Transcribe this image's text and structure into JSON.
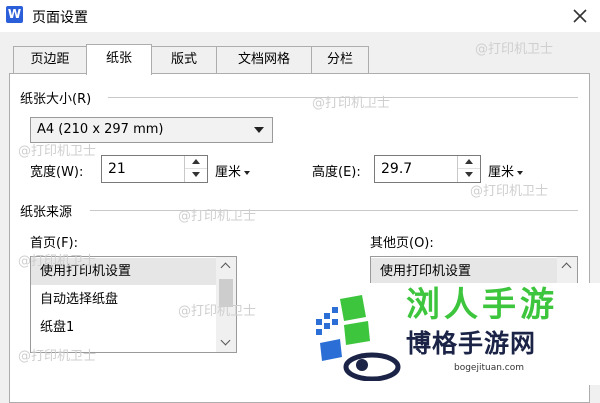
{
  "window": {
    "app_icon": "W",
    "title": "页面设置",
    "close_icon": "close-icon"
  },
  "tabs": [
    {
      "label": "页边距",
      "active": false
    },
    {
      "label": "纸张",
      "active": true
    },
    {
      "label": "版式",
      "active": false
    },
    {
      "label": "文档网格",
      "active": false
    },
    {
      "label": "分栏",
      "active": false
    }
  ],
  "paper_size": {
    "section_label": "纸张大小(R)",
    "selected": "A4 (210 x 297 mm)",
    "width": {
      "label": "宽度(W):",
      "value": "21",
      "unit": "厘米"
    },
    "height": {
      "label": "高度(E):",
      "value": "29.7",
      "unit": "厘米"
    }
  },
  "paper_source": {
    "section_label": "纸张来源",
    "first_page": {
      "label": "首页(F):",
      "items": [
        "使用打印机设置",
        "自动选择纸盘",
        "纸盘1"
      ],
      "selected_index": 0
    },
    "other_pages": {
      "label": "其他页(O):",
      "items": [
        "使用打印机设置"
      ],
      "selected_index": 0
    }
  },
  "watermark_text": "@打印机卫士",
  "brand": {
    "big_text": "浏人手游",
    "name": "博格手游网",
    "domain": "bogejituan.com",
    "accent_color": "#3ec53e",
    "logo_colors": [
      "#2b6fd6",
      "#3ec53e",
      "#1b2447"
    ]
  }
}
